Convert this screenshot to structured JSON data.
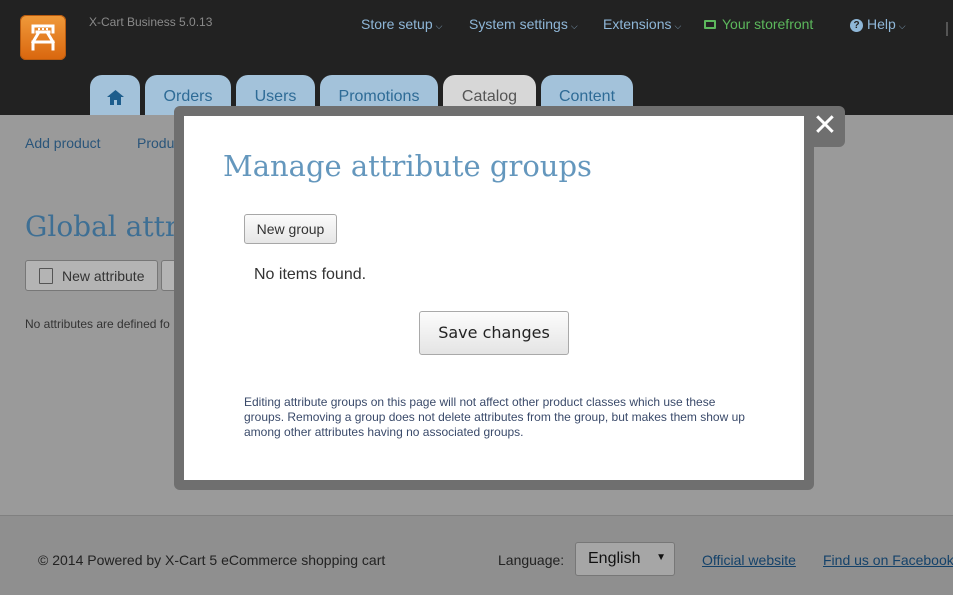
{
  "header": {
    "version": "X-Cart Business 5.0.13",
    "nav": [
      {
        "label": "Store setup",
        "chevron": "⌵"
      },
      {
        "label": "System settings",
        "chevron": "⌵"
      },
      {
        "label": "Extensions",
        "chevron": "⌵"
      }
    ],
    "storefront": "Your storefront",
    "help": "Help",
    "help_chevron": "⌵",
    "help_icon_glyph": "?",
    "tabs": [
      "Orders",
      "Users",
      "Promotions",
      "Catalog",
      "Content"
    ],
    "active_tab": "Catalog"
  },
  "page": {
    "sub_links": [
      "Add product",
      "Produ"
    ],
    "title": "Global attr",
    "new_attribute_label": "New attribute",
    "no_attributes_text": "No attributes are defined fo"
  },
  "modal": {
    "close_glyph": "✕",
    "title": "Manage attribute groups",
    "new_group_label": "New group",
    "empty_text": "No items found.",
    "save_label": "Save changes",
    "note": "Editing attribute groups on this page will not affect other product classes which use these groups. Removing a group does not delete attributes from the group, but makes them show up among other attributes having no associated groups."
  },
  "footer": {
    "copyright": "© 2014 Powered by X-Cart 5 eCommerce shopping cart",
    "language_label": "Language:",
    "language_value": "English",
    "language_arrow": "▼",
    "links": [
      "Official website",
      "Find us on Facebook"
    ]
  },
  "colors": {
    "header_bg": "#222222",
    "tab_bg": "#a3c2da",
    "modal_title": "#6497bd",
    "storefront": "#5cb85c",
    "logo": "#e27a1c"
  },
  "icons": [
    "x-cart-logo-icon",
    "monitor-icon",
    "help-icon",
    "home-icon",
    "attribute-icon",
    "close-icon"
  ]
}
